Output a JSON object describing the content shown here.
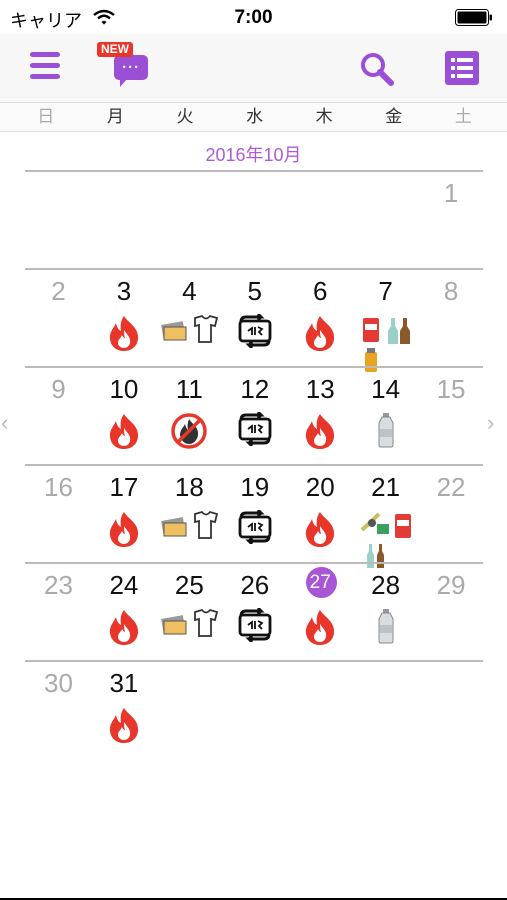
{
  "status_bar": {
    "carrier": "キャリア",
    "time": "7:00"
  },
  "toolbar": {
    "news_badge": "NEW",
    "news_dots": "···"
  },
  "weekdays": [
    "日",
    "月",
    "火",
    "水",
    "木",
    "金",
    "土"
  ],
  "month_label": "2016年10月",
  "colors": {
    "accent": "#9b4fd6",
    "today": "#a855d6",
    "burnable": "#e8362a"
  },
  "icon_types": {
    "fire": "burnable-garbage-icon",
    "paper_cloth": "paper-and-clothes-icon",
    "plastic": "plastic-recycle-icon",
    "cans_bottles": "cans-and-bottles-icon",
    "pet": "pet-bottle-icon",
    "no_fire": "no-burnable-collection-icon",
    "hazardous": "hazardous-waste-icon"
  },
  "weeks": [
    [
      null,
      null,
      null,
      null,
      null,
      null,
      {
        "day": "1",
        "dim": true
      }
    ],
    [
      {
        "day": "2",
        "dim": true
      },
      {
        "day": "3",
        "icons": [
          "fire"
        ]
      },
      {
        "day": "4",
        "icons": [
          "paper_cloth"
        ]
      },
      {
        "day": "5",
        "icons": [
          "plastic"
        ]
      },
      {
        "day": "6",
        "icons": [
          "fire"
        ]
      },
      {
        "day": "7",
        "icons": [
          "cans_bottles"
        ]
      },
      {
        "day": "8",
        "dim": true
      }
    ],
    [
      {
        "day": "9",
        "dim": true
      },
      {
        "day": "10",
        "icons": [
          "fire"
        ]
      },
      {
        "day": "11",
        "icons": [
          "no_fire"
        ]
      },
      {
        "day": "12",
        "icons": [
          "plastic"
        ]
      },
      {
        "day": "13",
        "icons": [
          "fire"
        ]
      },
      {
        "day": "14",
        "icons": [
          "pet"
        ]
      },
      {
        "day": "15",
        "dim": true
      }
    ],
    [
      {
        "day": "16",
        "dim": true
      },
      {
        "day": "17",
        "icons": [
          "fire"
        ]
      },
      {
        "day": "18",
        "icons": [
          "paper_cloth"
        ]
      },
      {
        "day": "19",
        "icons": [
          "plastic"
        ]
      },
      {
        "day": "20",
        "icons": [
          "fire"
        ]
      },
      {
        "day": "21",
        "icons": [
          "hazardous"
        ]
      },
      {
        "day": "22",
        "dim": true
      }
    ],
    [
      {
        "day": "23",
        "dim": true
      },
      {
        "day": "24",
        "icons": [
          "fire"
        ]
      },
      {
        "day": "25",
        "icons": [
          "paper_cloth"
        ]
      },
      {
        "day": "26",
        "icons": [
          "plastic"
        ]
      },
      {
        "day": "27",
        "icons": [
          "fire"
        ],
        "today": true
      },
      {
        "day": "28",
        "icons": [
          "pet"
        ]
      },
      {
        "day": "29",
        "dim": true
      }
    ],
    [
      {
        "day": "30",
        "dim": true
      },
      {
        "day": "31",
        "icons": [
          "fire"
        ]
      },
      null,
      null,
      null,
      null,
      null
    ]
  ]
}
